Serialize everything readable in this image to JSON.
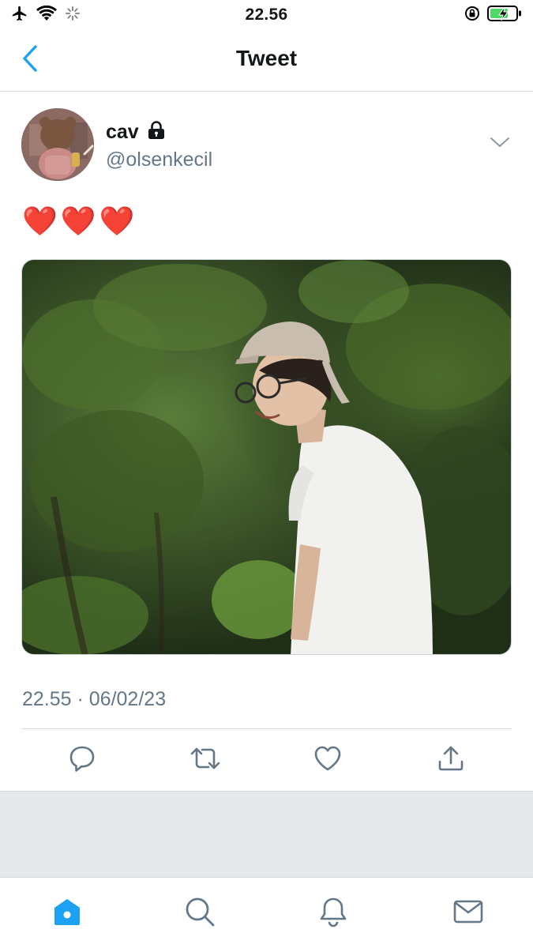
{
  "status_bar": {
    "time": "22.56",
    "icons": [
      "airplane-icon",
      "wifi-icon",
      "loading-spinner-icon",
      "orientation-lock-icon",
      "battery-charging-icon"
    ]
  },
  "nav": {
    "title": "Tweet",
    "back_icon": "chevron-left-icon"
  },
  "tweet": {
    "author": {
      "display_name": "cav",
      "handle": "@olsenkecil",
      "protected_icon": "lock-icon"
    },
    "text": "❤️❤️❤️",
    "media_icon": "photo",
    "timestamp": "22.55 · 06/02/23",
    "actions": [
      {
        "name": "reply",
        "icon": "comment-icon"
      },
      {
        "name": "retweet",
        "icon": "retweet-icon"
      },
      {
        "name": "like",
        "icon": "heart-icon"
      },
      {
        "name": "share",
        "icon": "share-icon"
      }
    ]
  },
  "tab_bar": {
    "items": [
      {
        "name": "home",
        "icon": "home-icon",
        "active": true
      },
      {
        "name": "search",
        "icon": "search-icon",
        "active": false
      },
      {
        "name": "notifications",
        "icon": "bell-icon",
        "active": false
      },
      {
        "name": "messages",
        "icon": "mail-icon",
        "active": false
      }
    ]
  },
  "colors": {
    "accent": "#1da1f2",
    "secondary_text": "#657786",
    "divider": "#d6d9db",
    "battery_green": "#4cd964"
  }
}
